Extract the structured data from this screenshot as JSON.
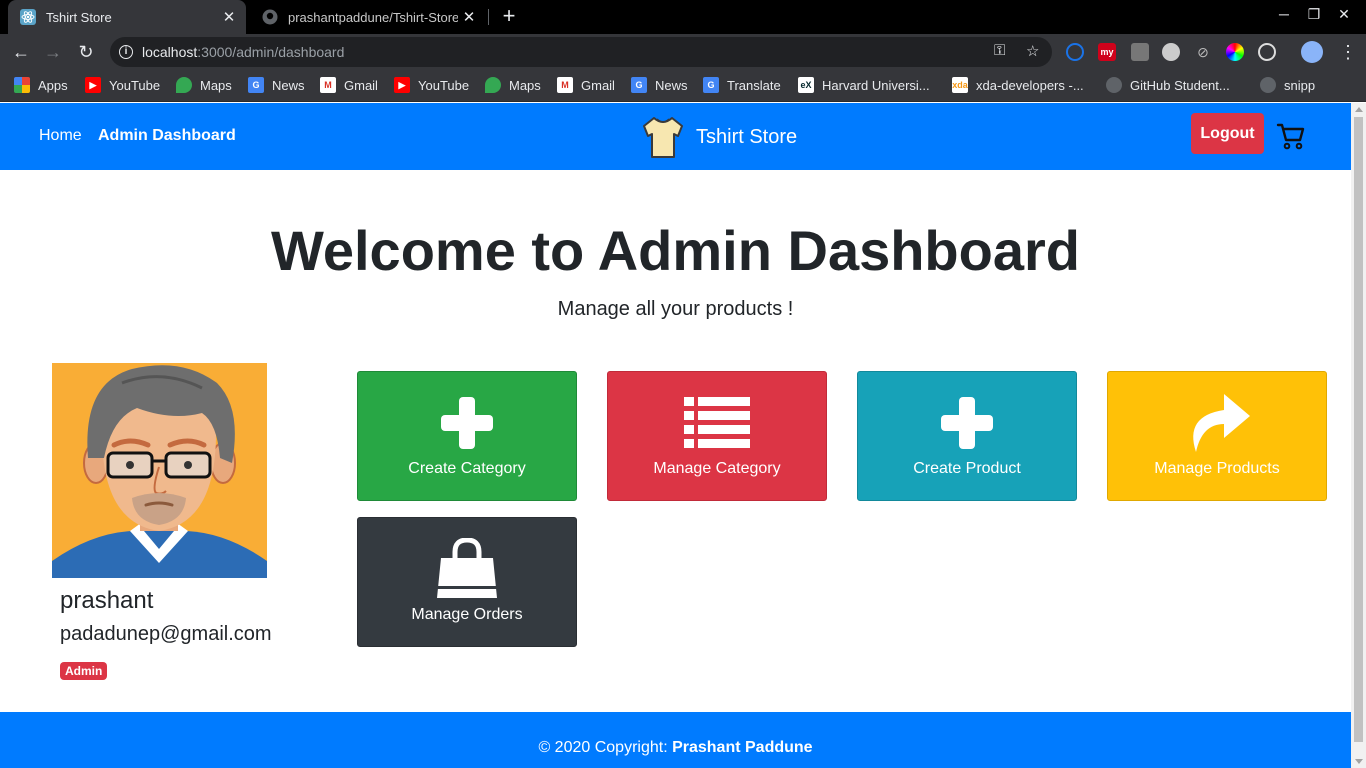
{
  "browser": {
    "tabs": [
      {
        "title": "Tshirt Store",
        "active": true
      },
      {
        "title": "prashantpaddune/Tshirt-Store",
        "active": false
      }
    ],
    "url_host": "localhost",
    "url_path": ":3000/admin/dashboard",
    "bookmarks": [
      {
        "label": "Apps",
        "icon": "apps-grid-icon"
      },
      {
        "label": "YouTube",
        "icon": "youtube-icon"
      },
      {
        "label": "Maps",
        "icon": "maps-icon"
      },
      {
        "label": "News",
        "icon": "google-news-icon"
      },
      {
        "label": "Gmail",
        "icon": "gmail-icon"
      },
      {
        "label": "YouTube",
        "icon": "youtube-icon"
      },
      {
        "label": "Maps",
        "icon": "maps-icon"
      },
      {
        "label": "Gmail",
        "icon": "gmail-icon"
      },
      {
        "label": "News",
        "icon": "google-news-icon"
      },
      {
        "label": "Translate",
        "icon": "translate-icon"
      },
      {
        "label": "Harvard Universi...",
        "icon": "edx-icon"
      },
      {
        "label": "xda-developers -...",
        "icon": "xda-icon"
      },
      {
        "label": "GitHub Student...",
        "icon": "github-icon"
      },
      {
        "label": "snipp",
        "icon": "github-icon"
      }
    ]
  },
  "navbar": {
    "links": [
      "Home",
      "Admin Dashboard"
    ],
    "brand": "Tshirt Store",
    "logout_label": "Logout"
  },
  "hero": {
    "title": "Welcome to Admin Dashboard",
    "subtitle": "Manage all your products !"
  },
  "user": {
    "name": "prashant",
    "email": "padadunep@gmail.com",
    "role": "Admin"
  },
  "cards": [
    {
      "label": "Create Category",
      "icon": "plus-icon",
      "color": "#28a745"
    },
    {
      "label": "Manage Category",
      "icon": "list-icon",
      "color": "#dc3545"
    },
    {
      "label": "Create Product",
      "icon": "plus-icon",
      "color": "#17a2b8"
    },
    {
      "label": "Manage Products",
      "icon": "share-arrow-icon",
      "color": "#ffc107"
    },
    {
      "label": "Manage Orders",
      "icon": "shopping-bag-icon",
      "color": "#343a40"
    }
  ],
  "footer": {
    "prefix": "© 2020 Copyright: ",
    "author": "Prashant Paddune"
  },
  "colors": {
    "primary": "#007bff",
    "danger": "#dc3545",
    "success": "#28a745",
    "info": "#17a2b8",
    "warning": "#ffc107",
    "dark": "#343a40"
  }
}
